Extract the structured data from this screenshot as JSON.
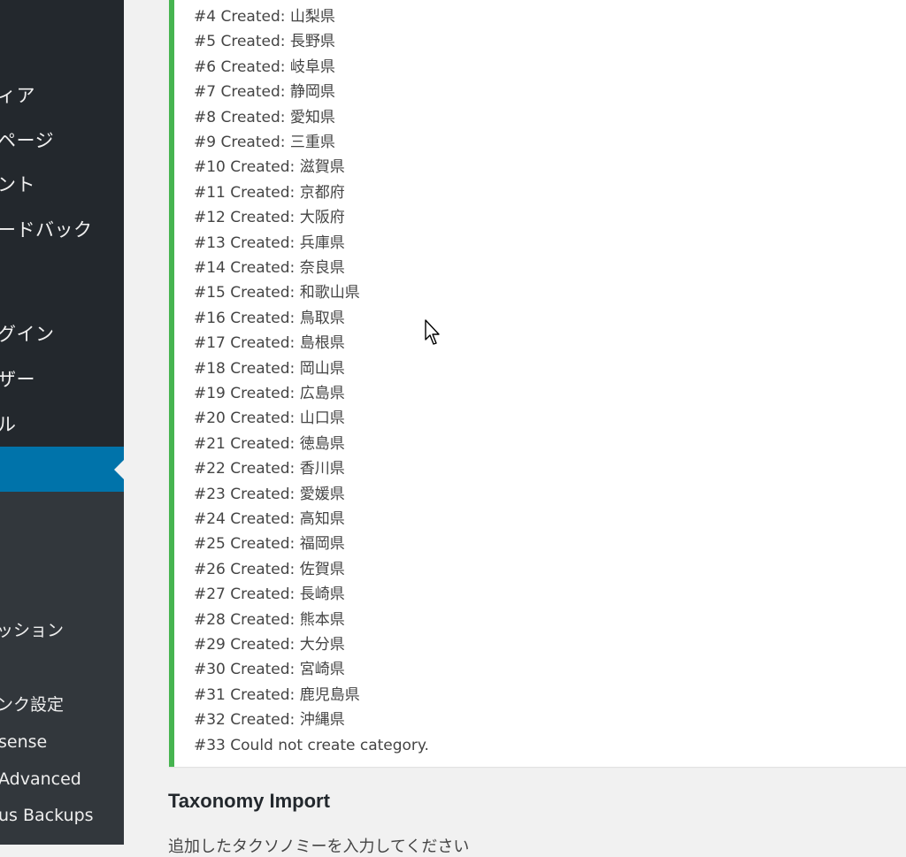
{
  "sidebar": {
    "menu": [
      "ィア",
      "ページ",
      "ント",
      "ードバック",
      "グイン",
      "ザー",
      "ル"
    ],
    "submenu": [
      "ッション",
      "ンク設定",
      "sense",
      "Advanced",
      "us Backups"
    ]
  },
  "log": {
    "lines": [
      "#4 Created: 山梨県",
      "#5 Created: 長野県",
      "#6 Created: 岐阜県",
      "#7 Created: 静岡県",
      "#8 Created: 愛知県",
      "#9 Created: 三重県",
      "#10 Created: 滋賀県",
      "#11 Created: 京都府",
      "#12 Created: 大阪府",
      "#13 Created: 兵庫県",
      "#14 Created: 奈良県",
      "#15 Created: 和歌山県",
      "#16 Created: 鳥取県",
      "#17 Created: 島根県",
      "#18 Created: 岡山県",
      "#19 Created: 広島県",
      "#20 Created: 山口県",
      "#21 Created: 徳島県",
      "#22 Created: 香川県",
      "#23 Created: 愛媛県",
      "#24 Created: 高知県",
      "#25 Created: 福岡県",
      "#26 Created: 佐賀県",
      "#27 Created: 長崎県",
      "#28 Created: 熊本県",
      "#29 Created: 大分県",
      "#30 Created: 宮崎県",
      "#31 Created: 鹿児島県",
      "#32 Created: 沖縄県",
      "#33 Could not create category."
    ]
  },
  "section": {
    "title": "Taxonomy Import",
    "description": "追加したタクソノミーを入力してください"
  },
  "colors": {
    "sidebar_bg": "#23282d",
    "submenu_bg": "#32373c",
    "current_item": "#0073aa",
    "success_border": "#46b450",
    "page_bg": "#f1f1f1"
  }
}
